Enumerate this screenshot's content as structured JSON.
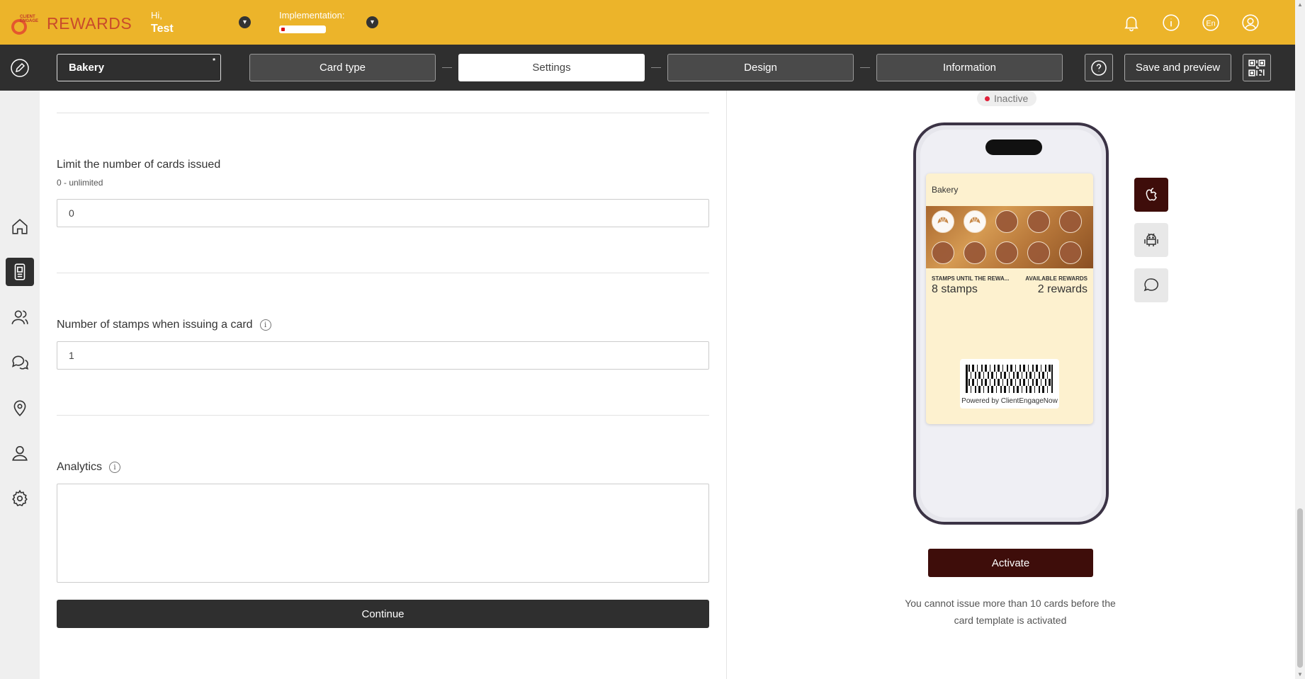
{
  "header": {
    "logo_text": "REWARDS",
    "logo_small": "CLIENT ENGAGE",
    "greeting": "Hi,",
    "user_name": "Test",
    "implementation_label": "Implementation:",
    "implementation_progress": 0.08,
    "icons": [
      "bell-icon",
      "info-icon",
      "language-icon",
      "user-icon"
    ],
    "language": "En"
  },
  "toolbar": {
    "card_name": "Bakery",
    "required_mark": "*",
    "steps": [
      "Card type",
      "Settings",
      "Design",
      "Information"
    ],
    "active_step": "Settings",
    "save_label": "Save and preview"
  },
  "sidebar": {
    "items": [
      "home-icon",
      "cards-icon",
      "clients-icon",
      "messages-icon",
      "locations-icon",
      "users-icon",
      "settings-icon"
    ],
    "active": "cards-icon"
  },
  "form": {
    "limit_label": "Limit the number of cards issued",
    "limit_hint": "0 - unlimited",
    "limit_value": "0",
    "stamps_label": "Number of stamps when issuing a card",
    "stamps_value": "1",
    "analytics_label": "Analytics",
    "info_glyph": "i",
    "continue_label": "Continue"
  },
  "preview": {
    "status": "Inactive",
    "status_color": "#e0203a",
    "card_title": "Bakery",
    "stamps_total": 10,
    "stamps_filled": 2,
    "field1_label": "STAMPS UNTIL THE REWA...",
    "field1_value": "8 stamps",
    "field2_label": "AVAILABLE REWARDS",
    "field2_value": "2 rewards",
    "powered_by": "Powered by ClientEngageNow",
    "platforms": [
      "apple-icon",
      "android-icon",
      "chat-icon"
    ],
    "activate_label": "Activate",
    "notice": "You cannot issue more than 10 cards before the card template is activated"
  },
  "colors": {
    "header_bg": "#ecb42a",
    "toolbar_bg": "#2f2f2f",
    "accent_dark": "#3e0d0a"
  }
}
